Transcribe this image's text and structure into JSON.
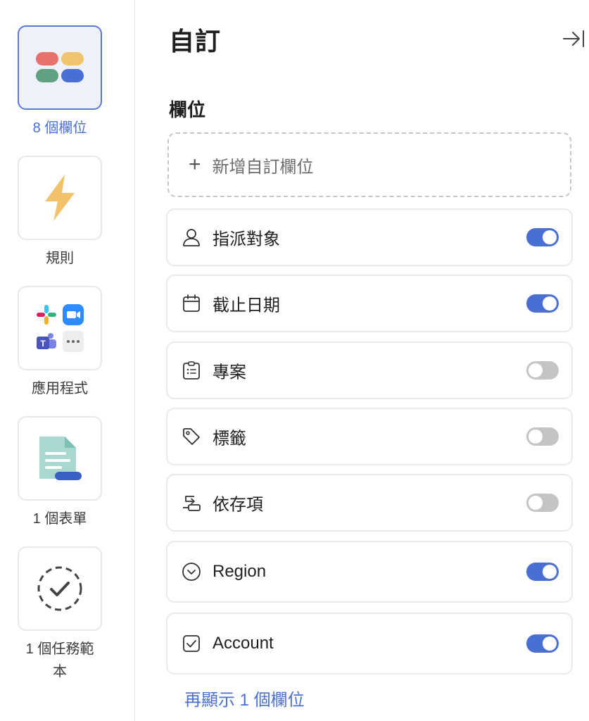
{
  "rail": {
    "items": [
      {
        "label": "8 個欄位",
        "icon": "fields-icon",
        "active": true
      },
      {
        "label": "規則",
        "icon": "lightning-bolt-icon",
        "active": false
      },
      {
        "label": "應用程式",
        "icon": "apps-icon",
        "active": false
      },
      {
        "label": "1 個表單",
        "icon": "form-icon",
        "active": false
      },
      {
        "label_line1": "1 個任務範",
        "label_line2": "本",
        "icon": "task-template-icon",
        "active": false
      }
    ]
  },
  "panel": {
    "title": "自訂",
    "section_title": "欄位",
    "add_field_label": "新增自訂欄位",
    "fields": [
      {
        "name": "指派對象",
        "icon": "person-icon",
        "enabled": true
      },
      {
        "name": "截止日期",
        "icon": "calendar-icon",
        "enabled": true
      },
      {
        "name": "專案",
        "icon": "clipboard-list-icon",
        "enabled": false
      },
      {
        "name": "標籤",
        "icon": "tag-icon",
        "enabled": false
      },
      {
        "name": "依存項",
        "icon": "dependency-icon",
        "enabled": false
      },
      {
        "name": "Region",
        "icon": "dropdown-circle-icon",
        "enabled": true
      },
      {
        "name": "Account",
        "icon": "checkbox-icon",
        "enabled": true
      }
    ],
    "show_more": "再顯示 1 個欄位"
  },
  "colors": {
    "accent": "#4a6fd4",
    "toggle_off": "#c4c4c6",
    "active_tile_bg": "#eef0fa"
  }
}
